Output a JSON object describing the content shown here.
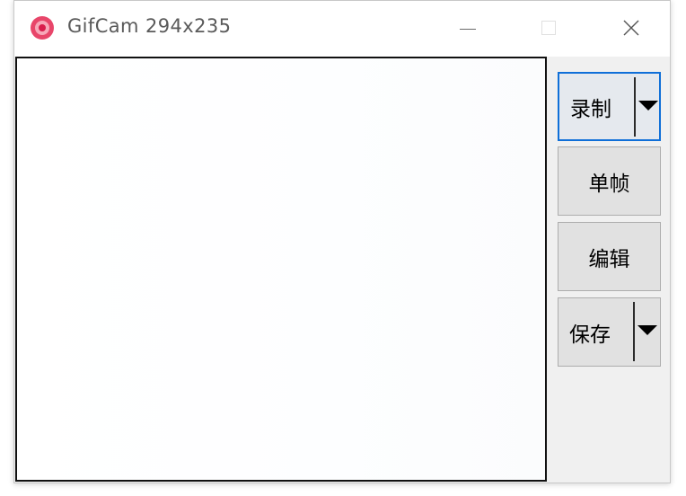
{
  "window": {
    "title": "GifCam 294x235"
  },
  "icons": {
    "app": "gifcam-app-icon",
    "minimize": "minimize-icon",
    "maximize": "maximize-icon",
    "close": "close-icon",
    "dropdown": "triangle-down-icon"
  },
  "buttons": {
    "record": "录制",
    "frame": "单帧",
    "edit": "编辑",
    "save": "保存"
  },
  "colors": {
    "focus_border": "#0f6fd8",
    "app_icon": "#e8466a",
    "button_bg": "#e1e1e1",
    "window_bg": "#f0f0f0"
  }
}
